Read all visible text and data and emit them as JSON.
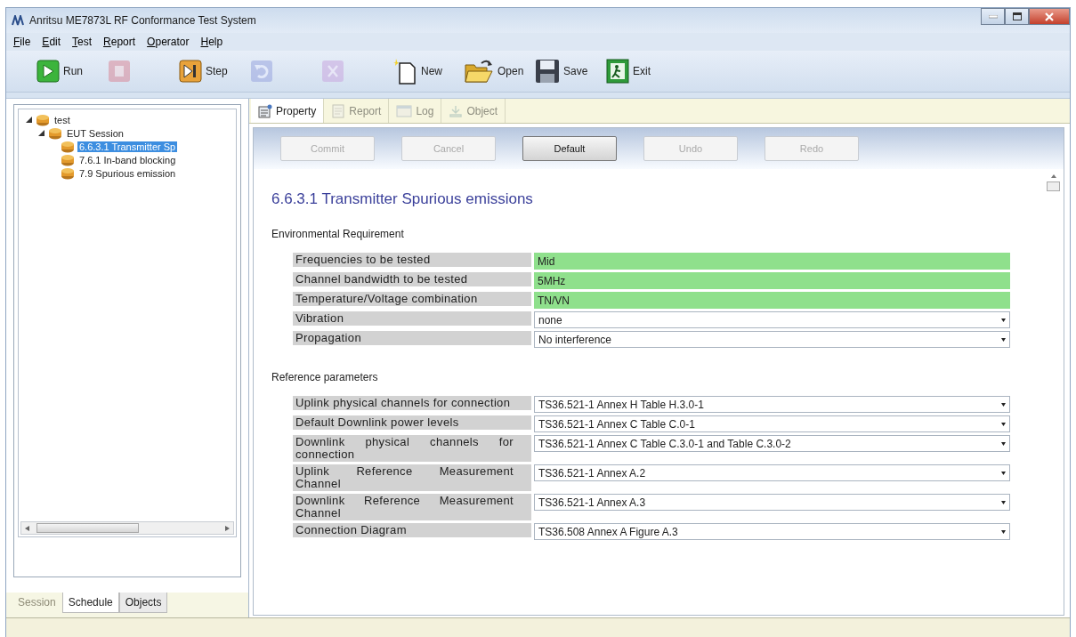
{
  "window": {
    "title": "Anritsu ME7873L RF Conformance Test System"
  },
  "menu": [
    "File",
    "Edit",
    "Test",
    "Report",
    "Operator",
    "Help"
  ],
  "toolbar": [
    {
      "kind": "run",
      "label": "Run",
      "disabled": false
    },
    {
      "kind": "stop",
      "disabled": true
    },
    {
      "kind": "step",
      "label": "Step",
      "disabled": false
    },
    {
      "kind": "undo",
      "disabled": true
    },
    {
      "kind": "cut",
      "disabled": true
    },
    {
      "kind": "new",
      "label": "New",
      "disabled": false
    },
    {
      "kind": "open",
      "label": "Open",
      "disabled": false
    },
    {
      "kind": "save",
      "label": "Save",
      "disabled": false
    },
    {
      "kind": "exit",
      "label": "Exit",
      "disabled": false
    }
  ],
  "tree": [
    {
      "label": "test",
      "expanded": true,
      "children": [
        {
          "label": "EUT Session",
          "expanded": true,
          "children": [
            {
              "label": "6.6.3.1 Transmitter Sp",
              "selected": true
            },
            {
              "label": "7.6.1 In-band blocking",
              "selected": false
            },
            {
              "label": "7.9 Spurious emission",
              "selected": false
            }
          ]
        }
      ]
    }
  ],
  "left_tabs": [
    {
      "label": "Session",
      "selected": false,
      "disabled": true
    },
    {
      "label": "Schedule",
      "selected": true,
      "disabled": false
    },
    {
      "label": "Objects",
      "selected": false,
      "disabled": false
    }
  ],
  "doc_tabs": [
    {
      "kind": "property",
      "label": "Property",
      "selected": true,
      "disabled": false
    },
    {
      "kind": "report",
      "label": "Report",
      "selected": false,
      "disabled": true
    },
    {
      "kind": "log",
      "label": "Log",
      "selected": false,
      "disabled": true
    },
    {
      "kind": "object",
      "label": "Object",
      "selected": false,
      "disabled": true
    }
  ],
  "action_buttons": [
    {
      "label": "Commit",
      "disabled": true
    },
    {
      "label": "Cancel",
      "disabled": true
    },
    {
      "label": "Default",
      "disabled": false
    },
    {
      "label": "Undo",
      "disabled": true
    },
    {
      "label": "Redo",
      "disabled": true
    }
  ],
  "heading": "6.6.3.1 Transmitter Spurious emissions",
  "sections": [
    {
      "title": "Environmental Requirement",
      "rows": [
        {
          "label": "Frequencies to be tested",
          "value": "Mid",
          "kind": "fixed"
        },
        {
          "label": "Channel bandwidth to be tested",
          "value": "5MHz",
          "kind": "fixed"
        },
        {
          "label": "Temperature/Voltage combination",
          "value": "TN/VN",
          "kind": "fixed"
        },
        {
          "label": "Vibration",
          "value": "none",
          "kind": "dropdown"
        },
        {
          "label": "Propagation",
          "value": "No interference",
          "kind": "dropdown"
        }
      ]
    },
    {
      "title": "Reference parameters",
      "rows": [
        {
          "label": "Uplink physical channels for connection",
          "value": "TS36.521-1 Annex H Table H.3.0-1",
          "kind": "dropdown"
        },
        {
          "label": "Default Downlink power levels",
          "value": "TS36.521-1 Annex C Table C.0-1",
          "kind": "dropdown"
        },
        {
          "label": "Downlink physical channels for connection",
          "value": "TS36.521-1 Annex C Table C.3.0-1 and Table C.3.0-2",
          "kind": "dropdown"
        },
        {
          "label": "Uplink Reference Measurement Channel",
          "value": "TS36.521-1 Annex A.2",
          "kind": "dropdown"
        },
        {
          "label": "Downlink Reference Measurement Channel",
          "value": "TS36.521-1 Annex A.3",
          "kind": "dropdown"
        },
        {
          "label": "Connection Diagram",
          "value": "TS36.508 Annex A Figure A.3",
          "kind": "dropdown"
        }
      ]
    }
  ]
}
